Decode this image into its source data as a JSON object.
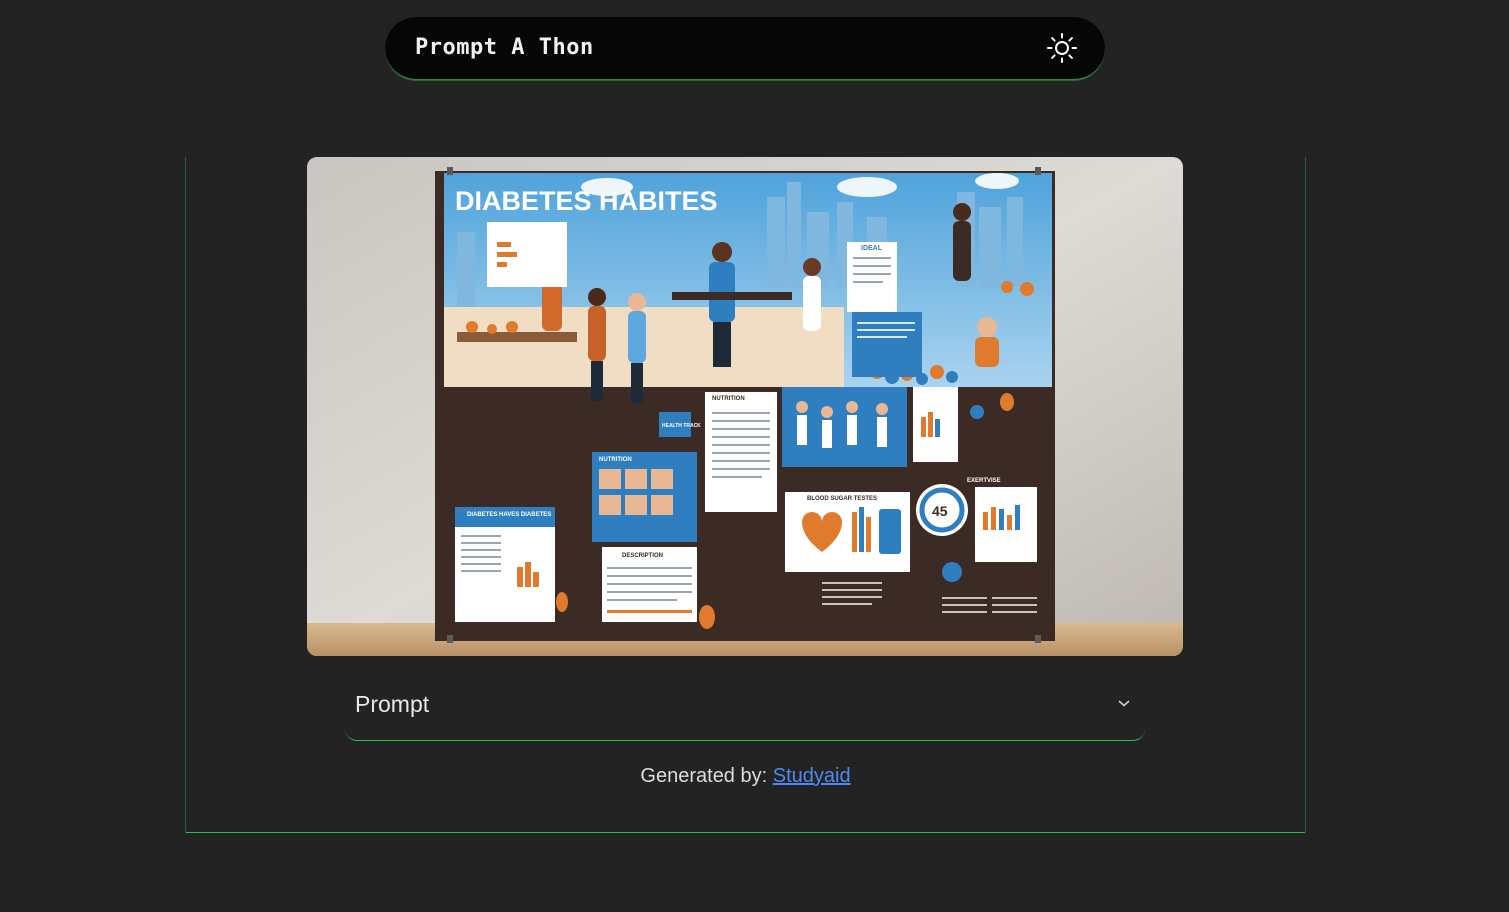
{
  "header": {
    "brand": "Prompt A Thon",
    "theme_toggle_icon": "sun-icon"
  },
  "poster": {
    "title": "DIABETES HABITES",
    "labels": {
      "ideal": "IDEAL",
      "health_track": "HEALTH TRACK",
      "nutrition": "NUTRITION",
      "diabetes_have": "DIABETES HAVES DIABETES",
      "blood_sugar": "BLOOD SUGAR TESTES",
      "exercise": "EXERTVISE",
      "nutrition_panel": "NUTRITION",
      "gauge_value": "45",
      "description": "DESCRIPTION"
    }
  },
  "accordion": {
    "label": "Prompt",
    "icon": "chevron-down-icon"
  },
  "credit": {
    "prefix": "Generated by: ",
    "link_text": "Studyaid"
  },
  "colors": {
    "background": "#232323",
    "accent_green": "#2ebd4a",
    "link_blue": "#4c8bf5",
    "poster_blue": "#2f7fc0",
    "poster_orange": "#e07a2c",
    "poster_dark": "#3a2a22"
  }
}
